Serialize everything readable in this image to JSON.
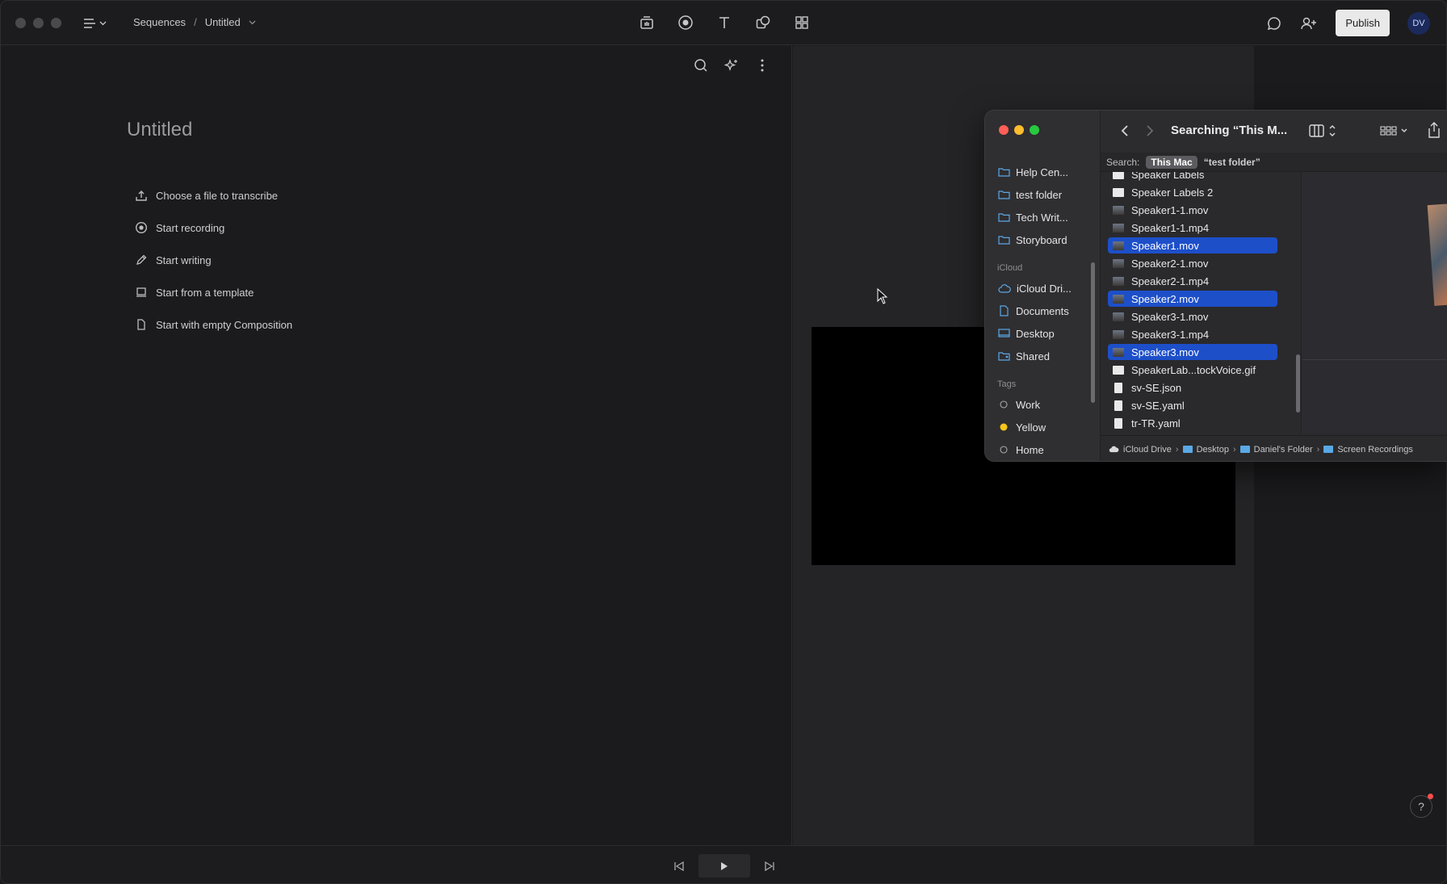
{
  "app": {
    "breadcrumb": {
      "root": "Sequences",
      "separator": "/",
      "current": "Untitled"
    },
    "publish_label": "Publish",
    "avatar_initials": "DV",
    "doc_title": "Untitled",
    "options": [
      {
        "label": "Choose a file to transcribe",
        "icon": "upload-icon"
      },
      {
        "label": "Start recording",
        "icon": "record-icon"
      },
      {
        "label": "Start writing",
        "icon": "pencil-icon"
      },
      {
        "label": "Start from a template",
        "icon": "template-icon"
      },
      {
        "label": "Start with empty Composition",
        "icon": "document-icon"
      }
    ],
    "help_label": "?"
  },
  "finder": {
    "title": "Searching “This M...",
    "search_label": "Search:",
    "scope_active": "This Mac",
    "scope_other": "“test folder”",
    "sidebar": {
      "favorites": [
        "Help Cen...",
        "test folder",
        "Tech Writ...",
        "Storyboard"
      ],
      "icloud_header": "iCloud",
      "icloud": [
        "iCloud Dri...",
        "Documents",
        "Desktop",
        "Shared"
      ],
      "tags_header": "Tags",
      "tags": [
        {
          "label": "Work",
          "color": "none"
        },
        {
          "label": "Yellow",
          "color": "#f5c518"
        },
        {
          "label": "Home",
          "color": "none"
        }
      ]
    },
    "files": [
      {
        "name": "Speaker Labels",
        "kind": "image-white",
        "selected": false
      },
      {
        "name": "Speaker Labels 2",
        "kind": "image-white",
        "selected": false
      },
      {
        "name": "Speaker1-1.mov",
        "kind": "video",
        "selected": false
      },
      {
        "name": "Speaker1-1.mp4",
        "kind": "video",
        "selected": false
      },
      {
        "name": "Speaker1.mov",
        "kind": "video",
        "selected": true
      },
      {
        "name": "Speaker2-1.mov",
        "kind": "video",
        "selected": false
      },
      {
        "name": "Speaker2-1.mp4",
        "kind": "video",
        "selected": false
      },
      {
        "name": "Speaker2.mov",
        "kind": "video",
        "selected": true
      },
      {
        "name": "Speaker3-1.mov",
        "kind": "video",
        "selected": false
      },
      {
        "name": "Speaker3-1.mp4",
        "kind": "video",
        "selected": false
      },
      {
        "name": "Speaker3.mov",
        "kind": "video",
        "selected": true
      },
      {
        "name": "SpeakerLab...tockVoice.gif",
        "kind": "image-white",
        "selected": false
      },
      {
        "name": "sv-SE.json",
        "kind": "doc",
        "selected": false
      },
      {
        "name": "sv-SE.yaml",
        "kind": "doc",
        "selected": false
      },
      {
        "name": "tr-TR.yaml",
        "kind": "doc",
        "selected": false
      }
    ],
    "path": [
      "iCloud Drive",
      "Desktop",
      "Daniel's Folder",
      "Screen Recordings"
    ],
    "path_separator": "›"
  },
  "colors": {
    "accent": "#1d4fc9",
    "close": "#ff5f57",
    "minimize": "#febc2e",
    "zoom": "#28c840"
  }
}
